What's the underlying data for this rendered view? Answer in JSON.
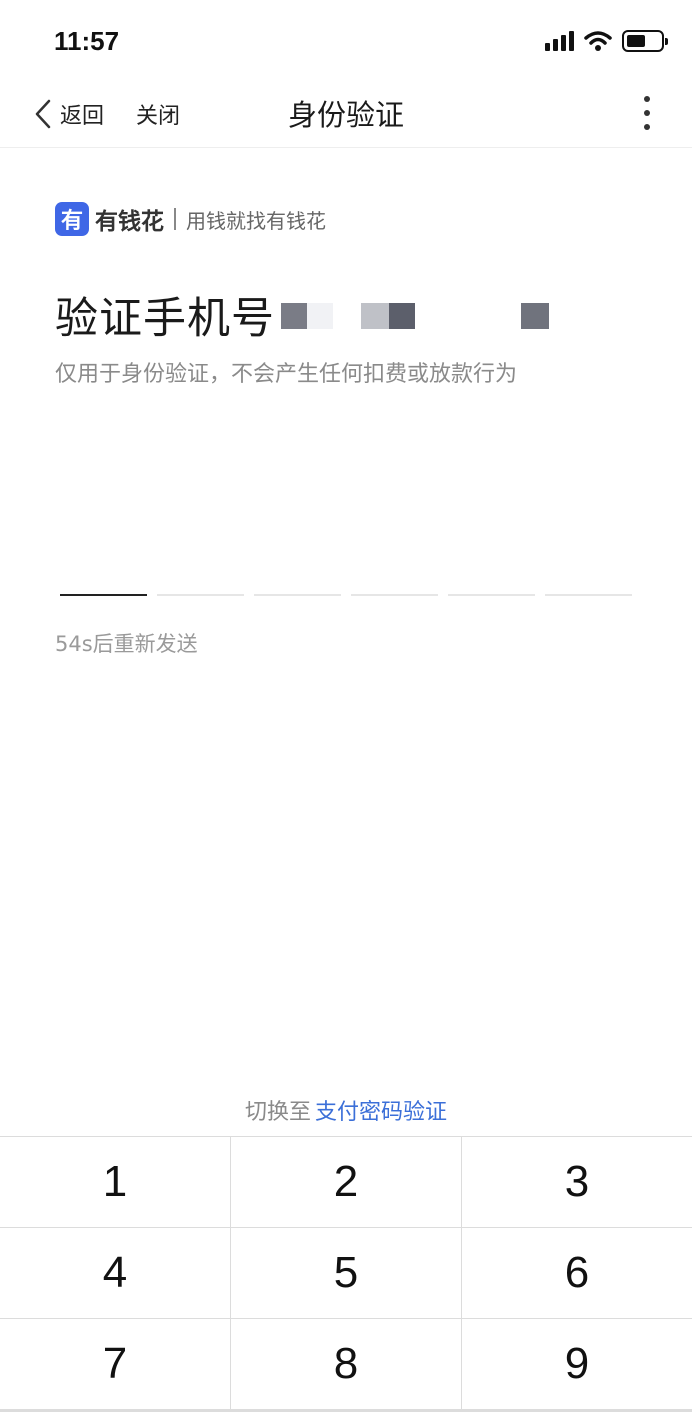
{
  "status_bar": {
    "time": "11:57",
    "icons": [
      "signal-icon",
      "wifi-icon",
      "battery-icon"
    ]
  },
  "nav": {
    "back_label": "返回",
    "close_label": "关闭",
    "title": "身份验证"
  },
  "brand": {
    "logo_glyph": "有",
    "name": "有钱花",
    "slogan": "用钱就找有钱花",
    "color": "#3f67e6"
  },
  "verify": {
    "title": "验证手机号",
    "subtitle": "仅用于身份验证，不会产生任何扣费或放款行为",
    "code_length": 6,
    "resend_text": "54s后重新发送"
  },
  "switch": {
    "prefix": "切换至",
    "link": "支付密码验证",
    "link_color": "#3b6fd8"
  },
  "keypad": {
    "keys": [
      "1",
      "2",
      "3",
      "4",
      "5",
      "6",
      "7",
      "8",
      "9"
    ]
  }
}
